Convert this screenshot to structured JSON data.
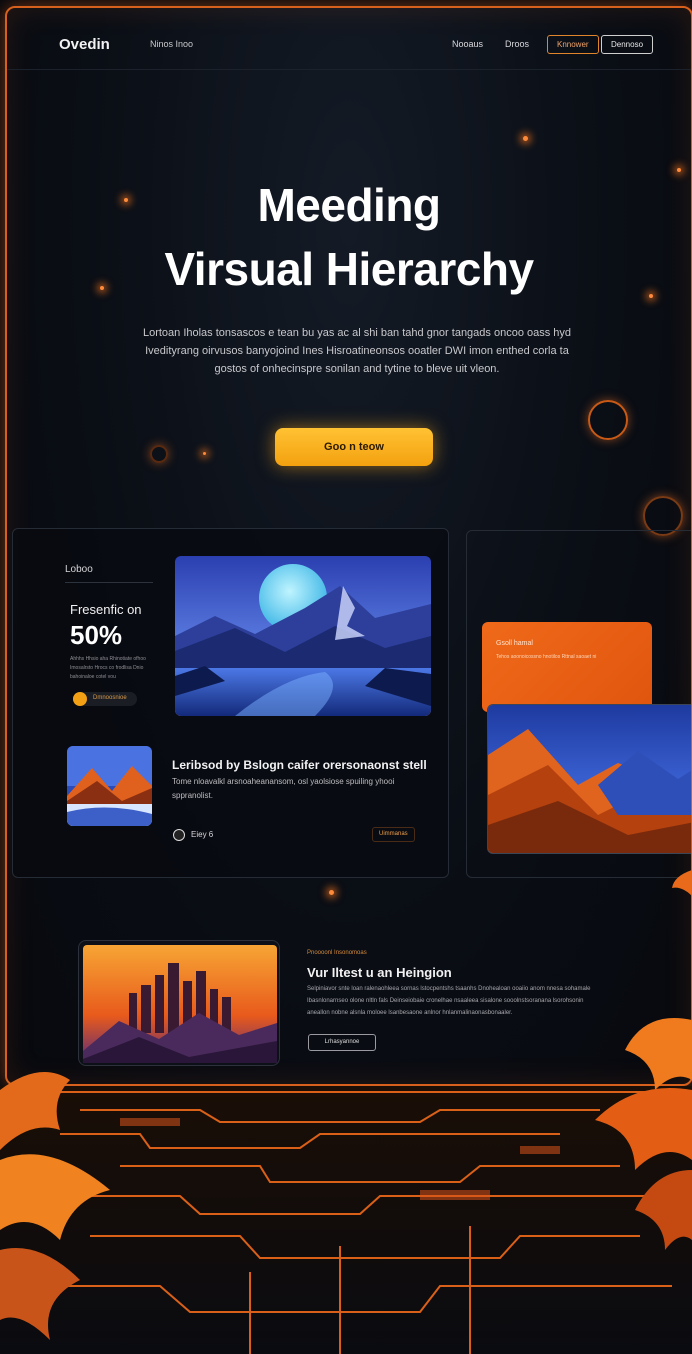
{
  "nav": {
    "logo": "Ovedin",
    "subtitle": "Ninos Inoo",
    "links": [
      "Nooaus",
      "Droos"
    ],
    "button_outline_orange": "Knnower",
    "button_outline_white": "Dennoso"
  },
  "hero": {
    "title_line1": "Meeding",
    "title_line2": "Virsual Hierarchy",
    "body": "Lortoan Iholas tonsascos e tean bu yas ac al shi ban tahd gnor tangads oncoo oass hyd Ivedityrang oirvusos banyojoind Ines Hisroatineonsos ooatler DWI imon enthed corla ta gostos of onhecinspre sonilan and tytine to bleve uit vleon.",
    "cta": "Goo n teow"
  },
  "feature_panel": {
    "label": "Loboo",
    "stat_label": "Fresenfic on",
    "stat_value": "50%",
    "stat_desc": "Ahhhs Hhsio aha Rhinotiate ofhoo Imosalrsto Hrocs co frodlisa Dnio bahoinaloe cotel vou",
    "chip_text": "Dmnoosnioe",
    "article_title": "Leribsod by Bslogn caifer orersonaonst stell",
    "article_body": "Tome nloavalkl arsnoaheanansom, osl yaolsiose spuiling yhooi sppranolist.",
    "article_meta": "Eiey 6",
    "article_tag": "Uimmanas"
  },
  "side_card": {
    "title": "Gsoll hamal",
    "text": "Tehos aoonoicossno hnotilos Rttnal saoaet ni"
  },
  "bottom_feature": {
    "kicker": "Pnoooonl Insonomoas",
    "title": "Vur Iltest u an Heingion",
    "body": "Selpiniavor snte loan ralenaohleea sornas lstocpentshs tsaanhs Dnohealoan ooaiio anom nnesa sohamale Ibasnlonarnseo olone nltln fals Deinseiobaie cronelhae nsaaleea sisalone sooolnstsoranana lsorohsonin aneallon nobne alsnla moloee lsanbesaone anlnor hnlanmalinaonasbonaaler.",
    "button": "Lrhasyannoe"
  },
  "colors": {
    "accent": "#f3a10f",
    "border_glow": "#d7611c",
    "background": "#07090e"
  }
}
